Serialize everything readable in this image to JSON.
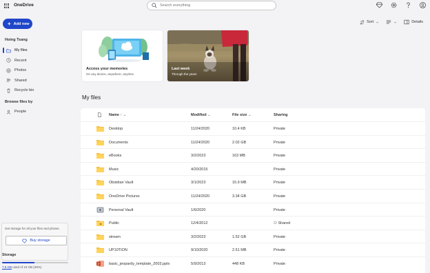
{
  "app": {
    "title": "OneDrive"
  },
  "search": {
    "placeholder": "Search everything"
  },
  "sidebar": {
    "add_new": "Add new",
    "user_name": "Hoing Tsang",
    "items": [
      {
        "label": "My files",
        "icon": "folder-icon",
        "active": true
      },
      {
        "label": "Recent",
        "icon": "clock-icon",
        "active": false
      },
      {
        "label": "Photos",
        "icon": "photo-icon",
        "active": false
      },
      {
        "label": "Shared",
        "icon": "people-icon",
        "active": false
      },
      {
        "label": "Recycle bin",
        "icon": "trash-icon",
        "active": false
      }
    ],
    "browse_heading": "Browse files by",
    "browse_items": [
      {
        "label": "People",
        "icon": "person-icon"
      }
    ]
  },
  "storage": {
    "promo": "Get storage for all your files and photos.",
    "buy_label": "Buy storage",
    "heading": "Storage",
    "used_text": "7.6 GB",
    "total_text": " used of 15 GB (49%)",
    "used_fraction": 0.49
  },
  "toolbar": {
    "sort_label": "Sort",
    "details_label": "Details"
  },
  "cards": [
    {
      "title": "Access your memories",
      "subtitle": "On any device, anywhere, anytime"
    },
    {
      "title": "Last week",
      "subtitle": "Through the years"
    }
  ],
  "section_title": "My files",
  "table": {
    "headers": {
      "name": "Name",
      "modified": "Modified",
      "size": "File size",
      "sharing": "Sharing"
    },
    "rows": [
      {
        "name": "Desktop",
        "modified": "11/24/2020",
        "size": "10.4 KB",
        "sharing": "Private",
        "type": "folder"
      },
      {
        "name": "Documents",
        "modified": "11/24/2020",
        "size": "2.02 GB",
        "sharing": "Private",
        "type": "folder"
      },
      {
        "name": "eBooks",
        "modified": "3/2/2023",
        "size": "163 MB",
        "sharing": "Private",
        "type": "folder"
      },
      {
        "name": "Music",
        "modified": "4/20/2015",
        "size": "",
        "sharing": "Private",
        "type": "folder"
      },
      {
        "name": "Obsidian Vault",
        "modified": "3/1/2023",
        "size": "15.9 MB",
        "sharing": "Private",
        "type": "folder"
      },
      {
        "name": "OneDrive Pictures",
        "modified": "11/24/2020",
        "size": "3.34 GB",
        "sharing": "Private",
        "type": "folder"
      },
      {
        "name": "Personal Vault",
        "modified": "1/6/2020",
        "size": "",
        "sharing": "Private",
        "type": "vault"
      },
      {
        "name": "Public",
        "modified": "12/4/2012",
        "size": "",
        "sharing": "Shared",
        "type": "shared-folder"
      },
      {
        "name": "stream",
        "modified": "3/2/2023",
        "size": "1.52 GB",
        "sharing": "Private",
        "type": "folder"
      },
      {
        "name": "UP10TION",
        "modified": "9/10/2020",
        "size": "2.51 MB",
        "sharing": "Private",
        "type": "folder"
      },
      {
        "name": "basic_jeopardy_template_2003.pptx",
        "modified": "5/9/2013",
        "size": "448 KB",
        "sharing": "Private",
        "type": "pptx"
      }
    ]
  },
  "colors": {
    "accent": "#1f46c9",
    "folder": "#f5c044",
    "background": "#f3f2f5"
  }
}
